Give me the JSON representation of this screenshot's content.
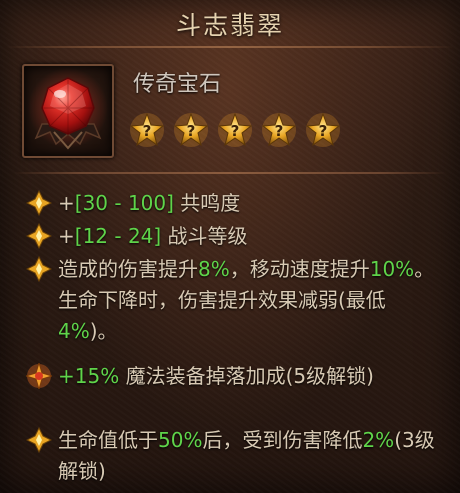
{
  "item": {
    "name": "斗志翡翠",
    "type": "传奇宝石",
    "star_rating": 5,
    "star_max": 5
  },
  "colors": {
    "highlight": "#5fd44a",
    "text": "#d8cab4",
    "title": "#e6d3b0",
    "star_gold": "#e8a523",
    "gem_red": "#d61f1c"
  },
  "stats": [
    {
      "icon": "diamond-bullet-icon",
      "parts": [
        {
          "t": "+",
          "g": false
        },
        {
          "t": "[30 - 100]",
          "g": true
        },
        {
          "t": " 共鸣度",
          "g": false
        }
      ]
    },
    {
      "icon": "diamond-bullet-icon",
      "parts": [
        {
          "t": "+",
          "g": false
        },
        {
          "t": "[12 - 24]",
          "g": true
        },
        {
          "t": " 战斗等级",
          "g": false
        }
      ]
    },
    {
      "icon": "diamond-bullet-icon",
      "parts": [
        {
          "t": "造成的伤害提升",
          "g": false
        },
        {
          "t": "8%",
          "g": true
        },
        {
          "t": "，移动速度提升",
          "g": false
        },
        {
          "t": "10%",
          "g": true
        },
        {
          "t": "。生命下降时，伤害提升效果减弱(最低",
          "g": false
        },
        {
          "t": "4%",
          "g": true
        },
        {
          "t": ")。",
          "g": false
        }
      ]
    },
    {
      "icon": "sparkle-bullet-icon",
      "parts": [
        {
          "t": "+15%",
          "g": true
        },
        {
          "t": " 魔法装备掉落加成(5级解锁)",
          "g": false
        }
      ]
    },
    {
      "icon": "diamond-bullet-icon",
      "parts": [
        {
          "t": "生命值低于",
          "g": false
        },
        {
          "t": "50%",
          "g": true
        },
        {
          "t": "后，受到伤害降低",
          "g": false
        },
        {
          "t": "2%",
          "g": true
        },
        {
          "t": "(3级解锁)",
          "g": false
        }
      ]
    }
  ]
}
